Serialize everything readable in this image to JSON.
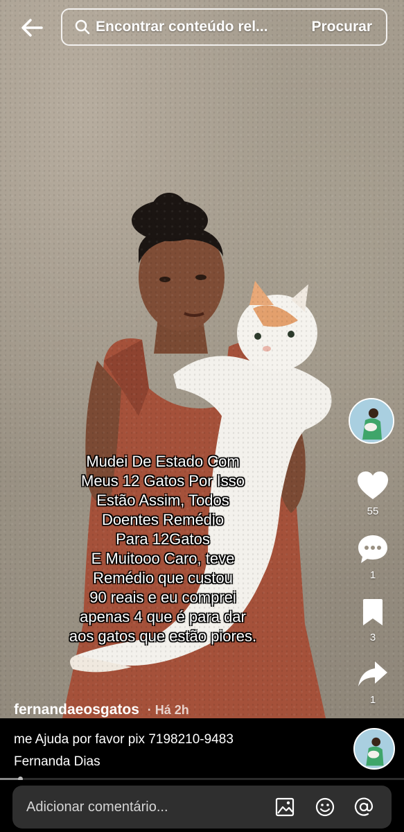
{
  "search": {
    "query": "Encontrar conteúdo rel...",
    "button_label": "Procurar"
  },
  "caption": {
    "lines": [
      "Mudei De Estado Com",
      "Meus 12 Gatos Por Isso",
      "Estão Assim, Todos",
      "Doentes Remédio",
      "Para 12Gatos",
      "E Muitooo Caro, teve",
      "Remédio que custou",
      "90 reais e eu comprei",
      "apenas 4 que é para dar",
      "aos gatos que estão piores."
    ]
  },
  "rail": {
    "likes": "55",
    "comments": "1",
    "saves": "3",
    "shares": "1"
  },
  "post": {
    "author": "fernandaeosgatos",
    "time": "· Há 2h",
    "description_line1": "me Ajuda por favor  pix 7198210-9483",
    "description_line2": "Fernanda Dias",
    "progress": 0.05
  },
  "comment": {
    "placeholder": "Adicionar comentário..."
  },
  "icons": {
    "back": "arrow-left-icon",
    "search": "search-icon",
    "like": "heart-icon",
    "comment": "comment-icon",
    "save": "bookmark-icon",
    "share": "share-icon",
    "image": "image-icon",
    "emoji": "emoji-icon",
    "mention": "at-icon"
  }
}
